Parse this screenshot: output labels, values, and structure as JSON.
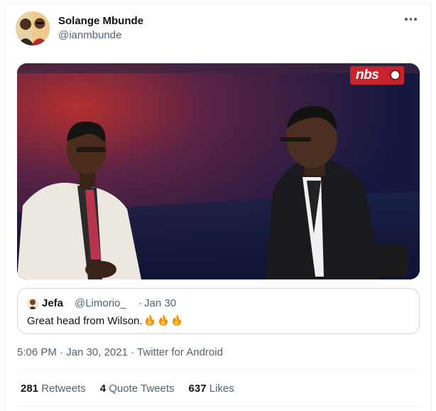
{
  "tweet": {
    "author_name": "Solange Mbunde",
    "author_handle": "@ianmbunde",
    "more_icon": "more-horizontal-icon",
    "media": {
      "channel_logo_text": "nbs"
    },
    "quote": {
      "name": "Jefa",
      "handle": "@Limorio_",
      "separator": "·",
      "date": "Jan 30",
      "text": "Great head from Wilson.",
      "emoji_icons": [
        "fire-icon",
        "fire-icon",
        "fire-icon"
      ]
    },
    "timestamp": "5:06 PM",
    "date_sep": "·",
    "date": "Jan 30, 2021",
    "source_sep": "·",
    "source": "Twitter for Android",
    "stats": [
      {
        "count": "281",
        "label": "Retweets"
      },
      {
        "count": "4",
        "label": "Quote Tweets"
      },
      {
        "count": "637",
        "label": "Likes"
      }
    ]
  },
  "colors": {
    "primary_text": "#0f1419",
    "secondary_text": "#536471",
    "border": "#cfd9de",
    "divider": "#eff3f4",
    "logo_red": "#c8232c"
  }
}
